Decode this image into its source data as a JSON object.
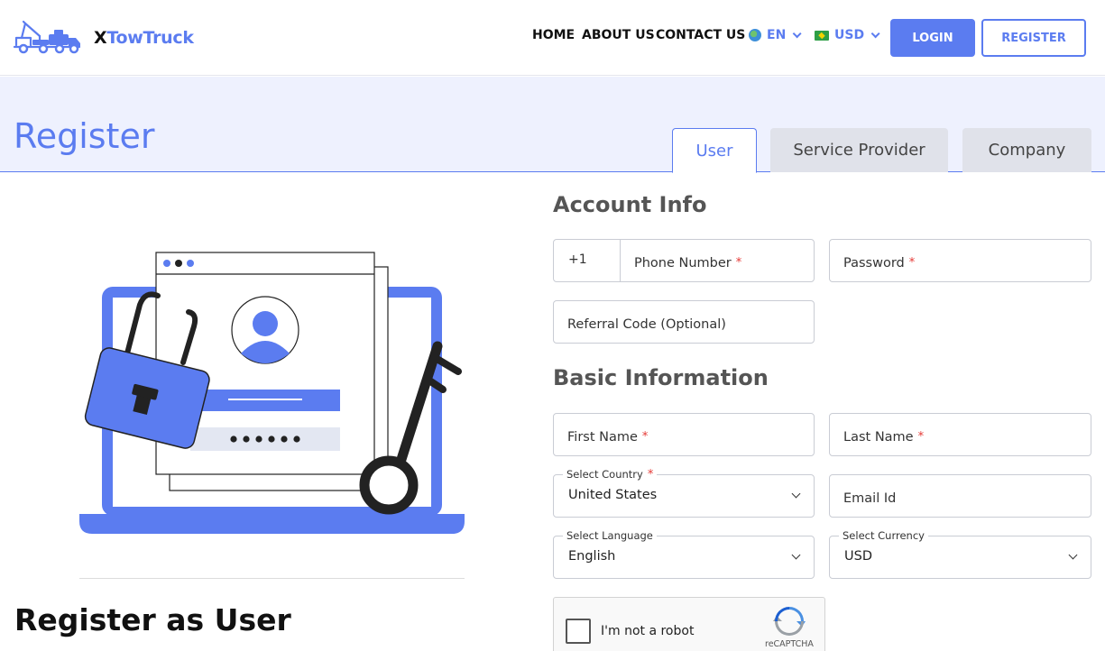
{
  "header": {
    "logo": {
      "x": "X",
      "rest": "TowTruck"
    },
    "nav": [
      "HOME",
      "ABOUT US",
      "CONTACT US"
    ],
    "language": "EN",
    "currency": "USD",
    "login_label": "LOGIN",
    "register_label": "REGISTER"
  },
  "banner": {
    "title": "Register",
    "tabs": [
      "User",
      "Service Provider",
      "Company"
    ],
    "active_tab": "User"
  },
  "left": {
    "heading": "Register as User"
  },
  "form": {
    "account_title": "Account Info",
    "phone_prefix": "+1",
    "phone_label": "Phone Number",
    "password_label": "Password",
    "referral_label": "Referral Code (Optional)",
    "basic_title": "Basic Information",
    "first_name_label": "First Name",
    "last_name_label": "Last Name",
    "country_label": "Select Country",
    "country_value": "United States",
    "email_label": "Email Id",
    "language_label": "Select Language",
    "language_value": "English",
    "currency_label": "Select Currency",
    "currency_value": "USD",
    "required_mark": "*"
  },
  "captcha": {
    "label": "I'm not a robot",
    "brand": "reCAPTCHA"
  },
  "colors": {
    "accent": "#5b7cf0",
    "banner_bg": "#eef1fe",
    "tab_inactive": "#e0e2ea",
    "required": "#e53935"
  }
}
